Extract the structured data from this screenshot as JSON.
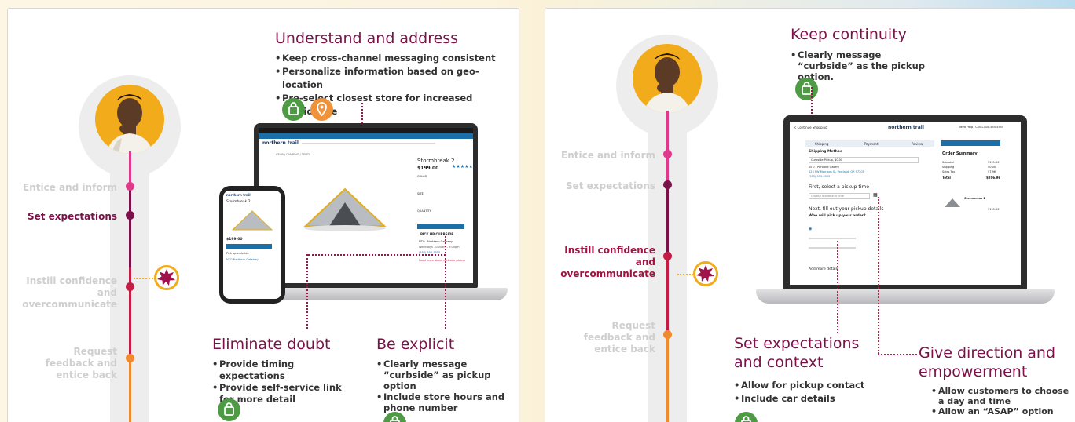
{
  "stages": {
    "entice": "Entice and inform",
    "set_expectations": "Set expectations",
    "instill": "Instill confidence and overcommunicate",
    "request": "Request feedback and entice back"
  },
  "left": {
    "understand": {
      "title": "Understand and address",
      "bullets": [
        "Keep cross-channel messaging consistent",
        "Personalize information based on geo-location",
        "Pre-select closest store for increased confidence"
      ]
    },
    "eliminate": {
      "title": "Eliminate doubt",
      "bullets": [
        "Provide timing expectations",
        "Provide self-service link for more detail"
      ]
    },
    "explicit": {
      "title": "Be explicit",
      "bullets": [
        "Clearly message “curbside” as pickup option",
        "Include store hours and phone number"
      ]
    },
    "laptop_screen": {
      "brand": "northern trail",
      "breadcrumb": "GEAR / CAMPING / TENTS",
      "product_name": "Stormbreak 2",
      "price": "$199.00",
      "color_label": "COLOR",
      "size_label": "SIZE",
      "qty_label": "QUANTITY",
      "add_to_cart": "ADD TO CART",
      "pickup_label": "PICK UP CURBSIDE",
      "store_name": "NTO - Northern Gateway",
      "store_info": "NTO Northern Gateway, Durham...",
      "hours": "Weekdays 10:00am - 9:00pm",
      "phone": "(555) 555-5555",
      "link": "Read more about curbside pickup"
    },
    "phone_screen": {
      "brand": "northern trail",
      "product_name": "Stormbreak 2",
      "price": "$199.00",
      "button": "ADD TO CART",
      "pickup": "Pick up curbside",
      "store": "NTO Northern Gateway"
    }
  },
  "right": {
    "continuity": {
      "title": "Keep continuity",
      "bullets": [
        "Clearly message “curbside” as the pickup option."
      ]
    },
    "set_expectations_context": {
      "title": "Set expectations and context",
      "bullets": [
        "Allow for pickup contact",
        "Include car details"
      ]
    },
    "give_direction": {
      "title": "Give direction and empowerment",
      "bullets": [
        "Allow customers to choose a day and time",
        "Allow an “ASAP” option"
      ]
    },
    "laptop_screen": {
      "back": "< Continue Shopping",
      "brand": "northern trail",
      "help": "Need Help? Call 1-800-555-5555",
      "steps": [
        "Shipping",
        "Payment",
        "Review"
      ],
      "shipping_method": "Shipping Method",
      "curbside": "Curbside Pickup, $0.00",
      "store_name": "NTO - Portland Gallery",
      "store_address": "123 SW Morrison St. Portland, OR 97205",
      "store_phone": "(555) 555-5555",
      "first_select": "First, select a pickup time",
      "choose_date": "Choose a date and time",
      "next_fill": "Next, fill out your pickup details",
      "who_pickup": "Who will pick up your order?",
      "add_more": "Add more details",
      "summary_button": "CHECKOUT",
      "order_summary": "Order Summary",
      "subtotal": "Subtotal",
      "subtotal_val": "$199.00",
      "shipping": "Shipping",
      "shipping_val": "$0.00",
      "tax": "Sales Tax",
      "tax_val": "$7.96",
      "total": "Total",
      "total_val": "$206.96",
      "item_name": "Stormbreak 2",
      "item_price": "$199.00"
    }
  },
  "colors": {
    "maroon": "#7a1249",
    "red": "#c51c45",
    "pink": "#e0398c",
    "orange": "#f08a2e",
    "gold": "#f1ab1b",
    "green": "#4f9a45",
    "blue": "#1b6fa8"
  },
  "icons": [
    "bag-icon",
    "location-pin-icon",
    "star-badge-icon",
    "person-avatar"
  ]
}
